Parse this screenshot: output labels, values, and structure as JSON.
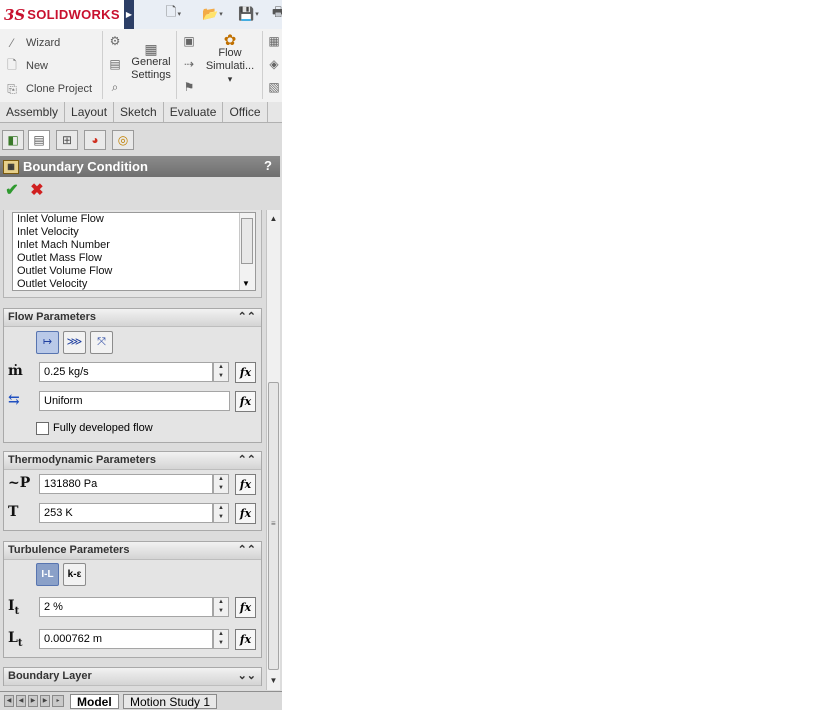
{
  "app": {
    "brand_prefix": "3S",
    "brand_name": "SOLIDWORKS"
  },
  "command_manager": {
    "left_items": [
      {
        "icon": "wand-icon",
        "label": "Wizard"
      },
      {
        "icon": "new-file-icon",
        "label": "New"
      },
      {
        "icon": "clone-icon",
        "label": "Clone Project"
      }
    ],
    "general_settings": "General Settings",
    "flow_simulation": "Flow Simulati...",
    "flow_dropdown": "▾"
  },
  "tabs": [
    "Assembly",
    "Layout",
    "Sketch",
    "Evaluate",
    "Office"
  ],
  "property_manager": {
    "title": "Boundary Condition",
    "help": "?",
    "ok": "✔",
    "cancel": "✖"
  },
  "type_list": [
    "Inlet Volume Flow",
    "Inlet Velocity",
    "Inlet Mach Number",
    "Outlet Mass Flow",
    "Outlet Volume Flow",
    "Outlet Velocity"
  ],
  "flow_parameters": {
    "title": "Flow Parameters",
    "mass_symbol": "ṁ",
    "mass_flow": "0.25 kg/s",
    "profile": "Uniform",
    "fully_developed_label": "Fully developed flow",
    "fully_developed_checked": false
  },
  "thermodynamic_parameters": {
    "title": "Thermodynamic Parameters",
    "pressure_symbol": "~P",
    "pressure": "131880 Pa",
    "temperature_symbol": "T",
    "temperature": "253 K"
  },
  "turbulence_parameters": {
    "title": "Turbulence Parameters",
    "mode_il": "I-L",
    "mode_ke": "k-ε",
    "intensity_symbol": "It",
    "intensity": "2 %",
    "length_symbol": "Lt",
    "length": "0.000762 m"
  },
  "boundary_layer": {
    "title": "Boundary Layer"
  },
  "bottom_tabs": [
    "Model",
    "Motion Study 1"
  ],
  "colors": {
    "brand_red": "#c8102e",
    "header_gray": "#7a7a7a",
    "selected_blue": "#b9c9e8"
  }
}
